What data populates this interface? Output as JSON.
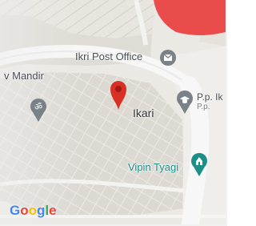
{
  "map": {
    "places": {
      "post_office": "Ikri Post Office",
      "mandir": "v Mandir",
      "ikari": "Ikari",
      "pp_label": "P.p. Ik",
      "pp_sub": "P.p.",
      "vipin": "Vipin Tyagi"
    },
    "logo": {
      "text": "Google",
      "letters": [
        "G",
        "o",
        "o",
        "g",
        "l",
        "e"
      ]
    },
    "icons": {
      "pin": "location-pin-icon",
      "post_office": "mail-icon",
      "mandir": "temple-om-icon",
      "pp": "school-icon",
      "vipin": "place-of-worship-icon"
    },
    "colors": {
      "pin": "#d93025",
      "road": "#f7f7f7",
      "poi_gray": "#7a8187",
      "poi_teal": "#1c8f86",
      "marker_top": "#ee4b4b"
    }
  }
}
